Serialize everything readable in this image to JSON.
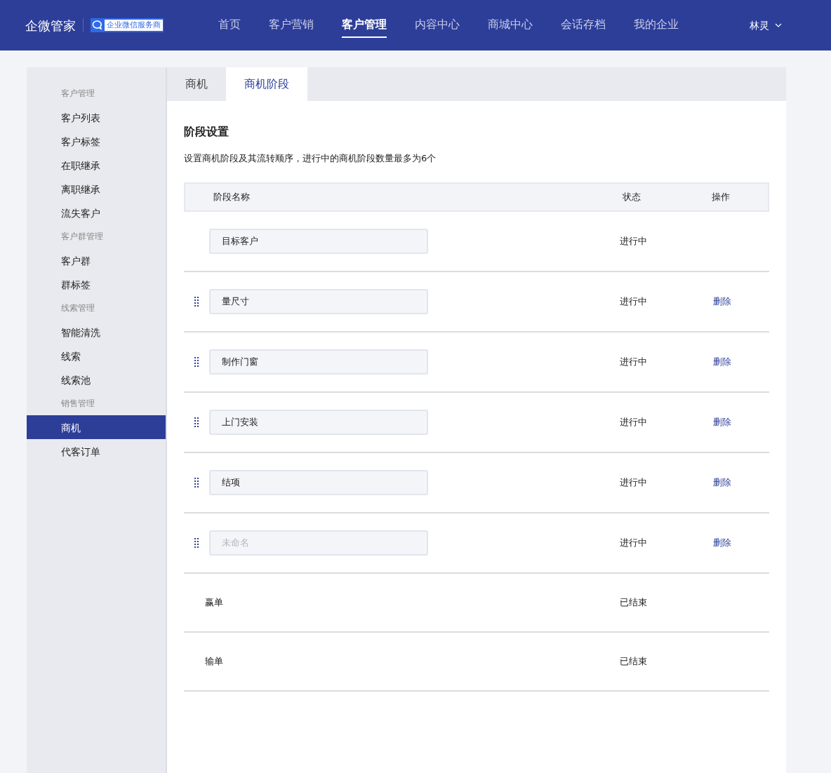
{
  "header": {
    "logo": "企微管家",
    "badge": "企业微信服务商",
    "nav": [
      {
        "label": "首页",
        "selected": false
      },
      {
        "label": "客户营销",
        "selected": false
      },
      {
        "label": "客户管理",
        "selected": true
      },
      {
        "label": "内容中心",
        "selected": false
      },
      {
        "label": "商城中心",
        "selected": false
      },
      {
        "label": "会话存档",
        "selected": false
      },
      {
        "label": "我的企业",
        "selected": false
      }
    ],
    "user": "林灵"
  },
  "sidebar": {
    "groups": [
      {
        "title": "客户管理",
        "items": [
          {
            "label": "客户列表",
            "selected": false
          },
          {
            "label": "客户标签",
            "selected": false
          },
          {
            "label": "在职继承",
            "selected": false
          },
          {
            "label": "离职继承",
            "selected": false
          },
          {
            "label": "流失客户",
            "selected": false
          }
        ]
      },
      {
        "title": "客户群管理",
        "items": [
          {
            "label": "客户群",
            "selected": false
          },
          {
            "label": "群标签",
            "selected": false
          }
        ]
      },
      {
        "title": "线索管理",
        "items": [
          {
            "label": "智能清洗",
            "selected": false
          },
          {
            "label": "线索",
            "selected": false
          },
          {
            "label": "线索池",
            "selected": false
          }
        ]
      },
      {
        "title": "销售管理",
        "items": [
          {
            "label": "商机",
            "selected": true
          },
          {
            "label": "代客订单",
            "selected": false
          }
        ]
      }
    ]
  },
  "tabs": [
    {
      "label": "商机",
      "selected": false
    },
    {
      "label": "商机阶段",
      "selected": true
    }
  ],
  "section": {
    "title": "阶段设置",
    "description": "设置商机阶段及其流转顺序，进行中的商机阶段数量最多为6个"
  },
  "table": {
    "columns": [
      "阶段名称",
      "状态",
      "操作"
    ],
    "rows": [
      {
        "kind": "input",
        "value": "目标客户",
        "draggable": false,
        "status": "进行中"
      },
      {
        "kind": "input",
        "value": "量尺寸",
        "draggable": true,
        "status": "进行中",
        "action": "删除"
      },
      {
        "kind": "input",
        "value": "制作门窗",
        "draggable": true,
        "status": "进行中",
        "action": "删除"
      },
      {
        "kind": "input",
        "value": "上门安装",
        "draggable": true,
        "status": "进行中",
        "action": "删除"
      },
      {
        "kind": "input",
        "value": "结项",
        "draggable": true,
        "status": "进行中",
        "action": "删除"
      },
      {
        "kind": "input",
        "placeholder": "未命名",
        "draggable": true,
        "status": "进行中",
        "action": "删除"
      },
      {
        "kind": "fixed",
        "name": "赢单",
        "status": "已结束"
      },
      {
        "kind": "fixed",
        "name": "输单",
        "status": "已结束"
      }
    ]
  }
}
